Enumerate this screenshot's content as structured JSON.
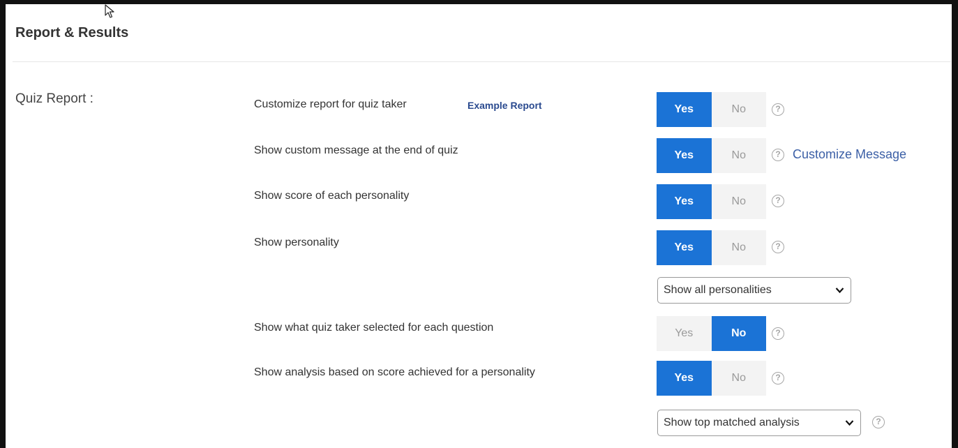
{
  "section": {
    "title": "Report & Results"
  },
  "group": {
    "label": "Quiz Report :"
  },
  "settings": [
    {
      "label": "Customize report for quiz taker",
      "extra_link": "Example Report",
      "yes": "Yes",
      "no": "No",
      "selected": "Yes"
    },
    {
      "label": "Show custom message at the end of quiz",
      "extra_link": "Customize Message",
      "yes": "Yes",
      "no": "No",
      "selected": "Yes"
    },
    {
      "label": "Show score of each personality",
      "yes": "Yes",
      "no": "No",
      "selected": "Yes"
    },
    {
      "label": "Show personality",
      "yes": "Yes",
      "no": "No",
      "selected": "Yes"
    },
    {
      "label": "Show what quiz taker selected for each question",
      "yes": "Yes",
      "no": "No",
      "selected": "No"
    },
    {
      "label": "Show analysis based on score achieved for a personality",
      "yes": "Yes",
      "no": "No",
      "selected": "Yes"
    }
  ],
  "selects": {
    "personality_display": {
      "value": "Show all personalities"
    },
    "analysis_display": {
      "value": "Show top matched analysis"
    }
  },
  "icons": {
    "help": "?",
    "help_icon_name": "question-circle-icon",
    "dropdown_icon_name": "chevron-down-icon"
  },
  "colors": {
    "accent": "#1b73d6",
    "off_bg": "#f3f3f3",
    "link": "#2a4a8f"
  }
}
